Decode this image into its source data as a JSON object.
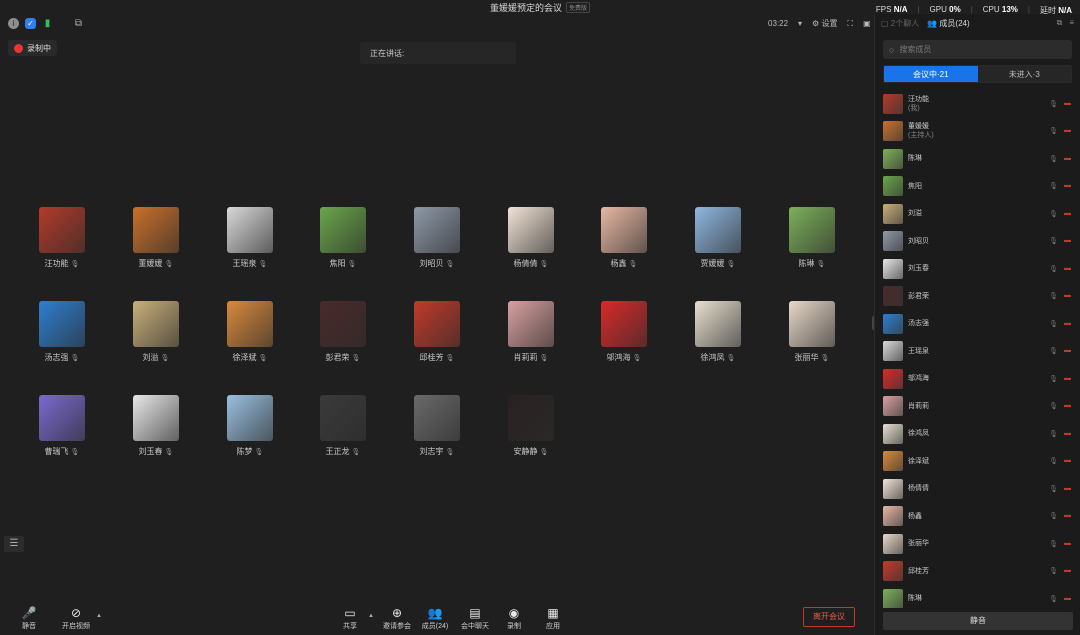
{
  "header": {
    "meeting_title": "董媛媛预定的会议",
    "title_tag": "免费版",
    "stats": {
      "fps_label": "FPS",
      "fps": "N/A",
      "gpu_label": "GPU",
      "gpu": "0%",
      "cpu_label": "CPU",
      "cpu": "13%",
      "delay_label": "延时",
      "delay": "N/A"
    },
    "timer": "03:22",
    "settings_label": "设置"
  },
  "recording": {
    "label": "录制中"
  },
  "speaking": {
    "label": "正在讲话:"
  },
  "participants": [
    {
      "name": "汪功能",
      "color": "#b33a2a"
    },
    {
      "name": "董媛媛",
      "color": "#c9702c"
    },
    {
      "name": "王瑶泉",
      "color": "#d9d9d9"
    },
    {
      "name": "焦阳",
      "color": "#6aa64a"
    },
    {
      "name": "刘昭贝",
      "color": "#8e99a8"
    },
    {
      "name": "杨倩倩",
      "color": "#f2e4d6"
    },
    {
      "name": "杨鑫",
      "color": "#e8b8a4"
    },
    {
      "name": "贾媛媛",
      "color": "#8fb7e0"
    },
    {
      "name": "陈琳",
      "color": "#7db05a"
    },
    {
      "name": "汤志强",
      "color": "#2e7fd1"
    },
    {
      "name": "刘溢",
      "color": "#c9b07a"
    },
    {
      "name": "徐泽斌",
      "color": "#d98a3c"
    },
    {
      "name": "彭君荣",
      "color": "#4a2a2a"
    },
    {
      "name": "邱桂芳",
      "color": "#c23a2a"
    },
    {
      "name": "肖莉莉",
      "color": "#d9a0a0"
    },
    {
      "name": "邬鸿海",
      "color": "#d92a2a"
    },
    {
      "name": "徐鸿凤",
      "color": "#e8e0d0"
    },
    {
      "name": "张丽华",
      "color": "#e8d8c8"
    },
    {
      "name": "曹瑞飞",
      "color": "#7a6ad0"
    },
    {
      "name": "刘玉春",
      "color": "#e8e8e8"
    },
    {
      "name": "陈梦",
      "color": "#9ac0e0"
    },
    {
      "name": "王正龙",
      "color": "#3a3a3a"
    },
    {
      "name": "刘志宇",
      "color": "#6a6a6a"
    },
    {
      "name": "安静静",
      "color": "#2a2222"
    }
  ],
  "sidebar": {
    "chat_tab": "2个聊人",
    "members_tab": "成员(24)",
    "search_placeholder": "搜索成员",
    "tab_in_meeting": "会议中·21",
    "tab_not_joined": "未进入·3",
    "mute_all": "静音",
    "members": [
      {
        "name": "汪功能",
        "sub": "(我)",
        "color": "#b33a2a"
      },
      {
        "name": "董媛媛",
        "sub": "(主持人)",
        "color": "#c9702c"
      },
      {
        "name": "陈琳",
        "color": "#7db05a"
      },
      {
        "name": "焦阳",
        "color": "#6aa64a"
      },
      {
        "name": "刘溢",
        "color": "#c9b07a"
      },
      {
        "name": "刘昭贝",
        "color": "#8e99a8"
      },
      {
        "name": "刘玉春",
        "color": "#e8e8e8"
      },
      {
        "name": "彭君荣",
        "color": "#4a2a2a"
      },
      {
        "name": "汤志强",
        "color": "#2e7fd1"
      },
      {
        "name": "王瑶泉",
        "color": "#d9d9d9"
      },
      {
        "name": "邬鸿海",
        "color": "#d92a2a"
      },
      {
        "name": "肖莉莉",
        "color": "#d9a0a0"
      },
      {
        "name": "徐鸿凤",
        "color": "#e8e0d0"
      },
      {
        "name": "徐泽斌",
        "color": "#d98a3c"
      },
      {
        "name": "杨倩倩",
        "color": "#f2e4d6"
      },
      {
        "name": "杨鑫",
        "color": "#e8b8a4"
      },
      {
        "name": "张丽华",
        "color": "#e8d8c8"
      },
      {
        "name": "邱桂芳",
        "color": "#c23a2a"
      },
      {
        "name": "陈琳",
        "color": "#7db05a"
      }
    ]
  },
  "toolbar": {
    "mute": "静音",
    "video": "开启视频",
    "share": "共享",
    "invite": "邀请参会",
    "members": "成员(24)",
    "chat": "会中聊天",
    "record": "录制",
    "apps": "应用",
    "leave": "离开会议"
  }
}
